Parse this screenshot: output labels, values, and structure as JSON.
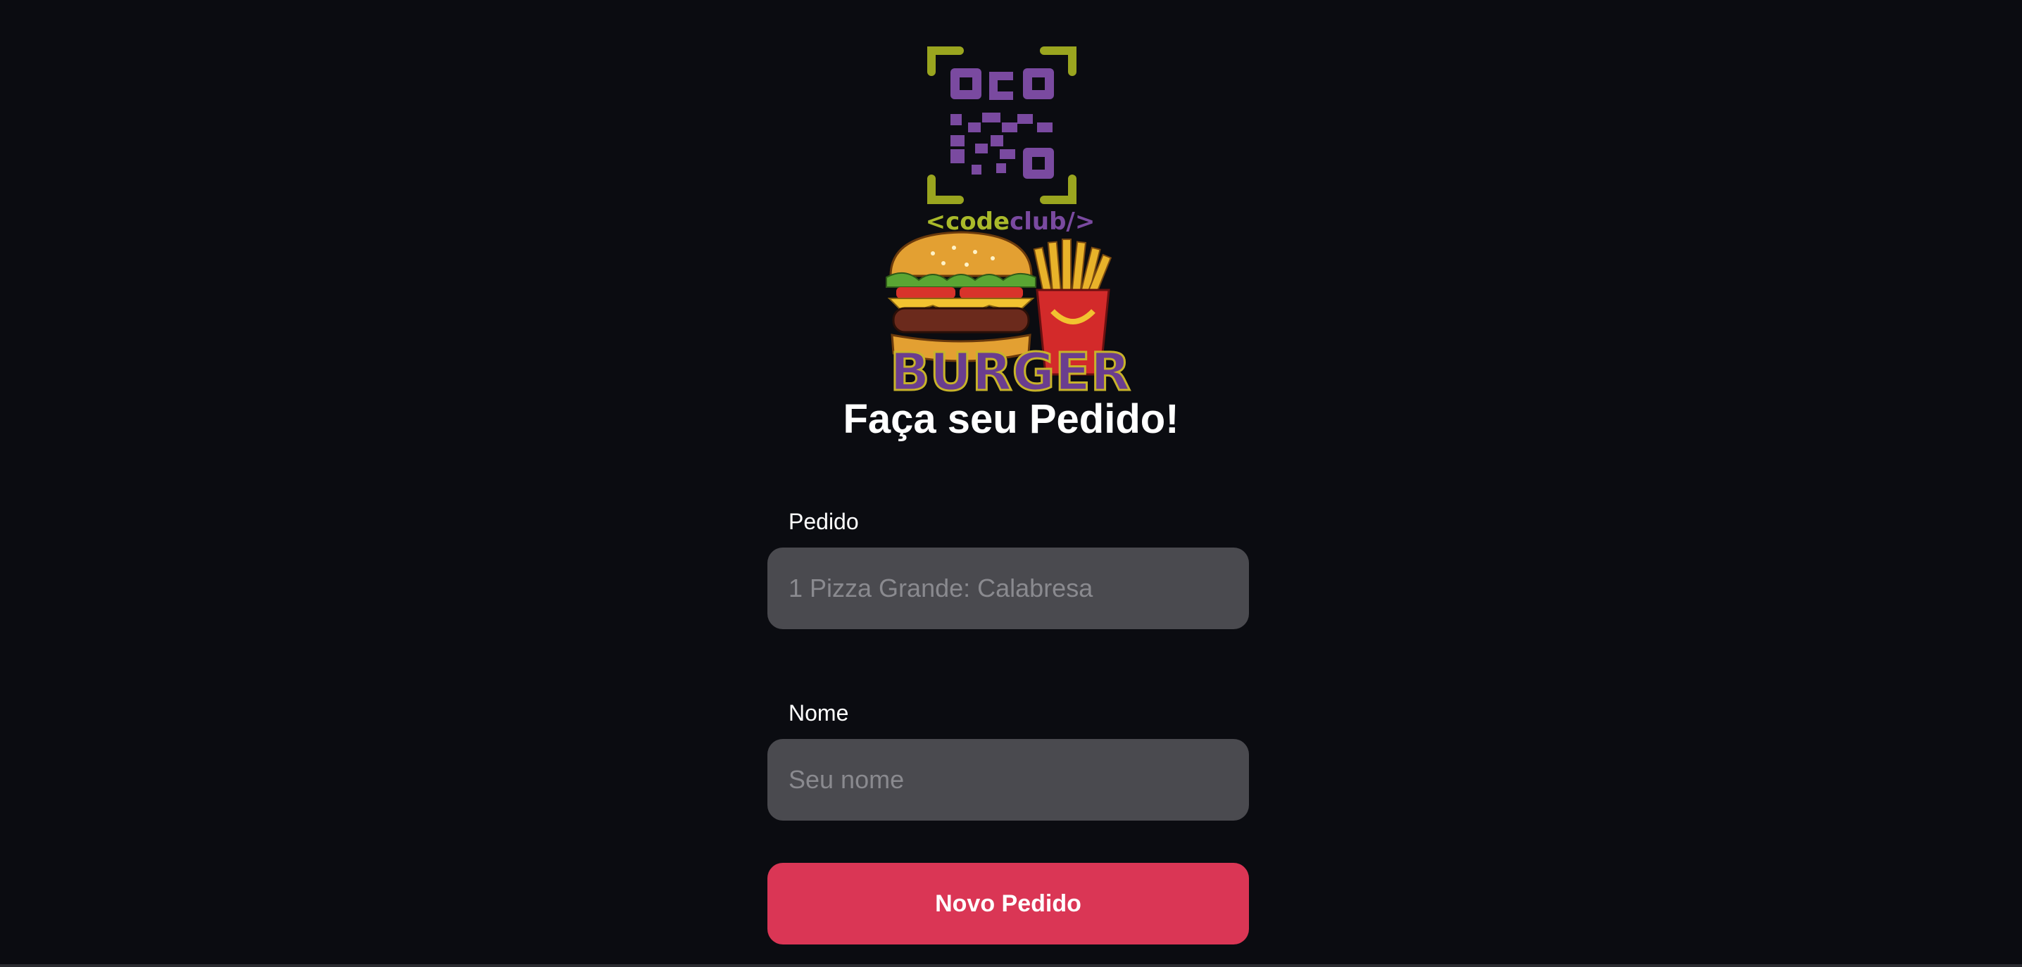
{
  "logo": {
    "brand_text_open": "<code",
    "brand_text_club": "club/>",
    "word": "BURGER",
    "colors": {
      "qr_purple": "#7a4aa0",
      "bracket_olive": "#9aa51f",
      "code_green": "#a9b92a",
      "burger_purple": "#6a3d8f"
    }
  },
  "title": "Faça seu Pedido!",
  "form": {
    "order_label": "Pedido",
    "order_placeholder": "1 Pizza Grande: Calabresa",
    "name_label": "Nome",
    "name_placeholder": "Seu nome",
    "submit_label": "Novo Pedido"
  },
  "colors": {
    "background": "#0b0c11",
    "input_bg": "#4a4a4f",
    "button_bg": "#da3655"
  }
}
